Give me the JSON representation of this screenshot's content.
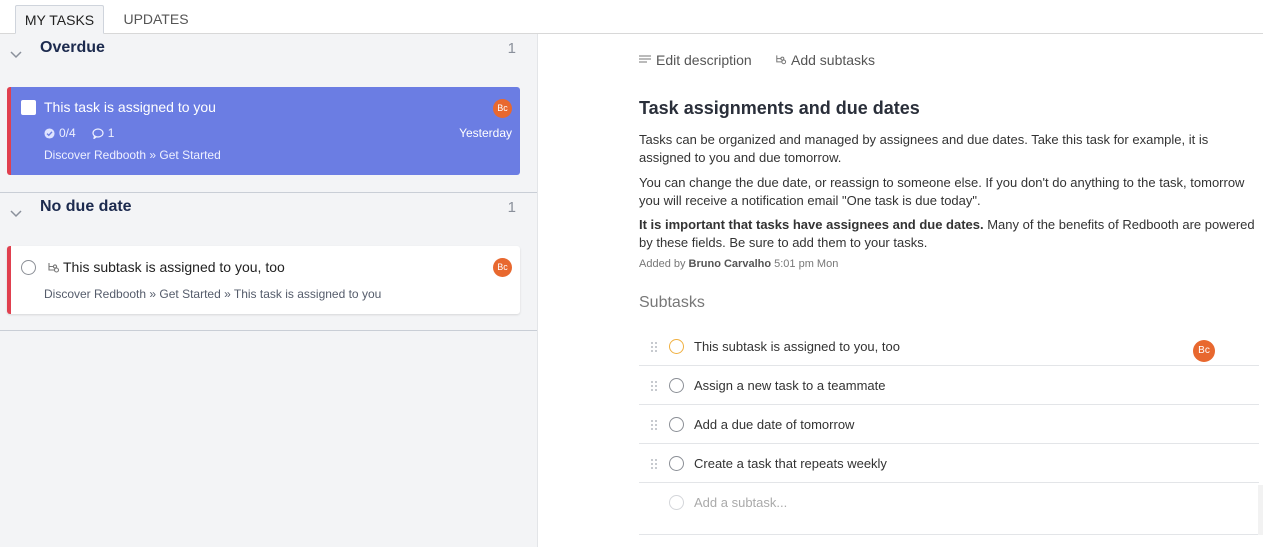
{
  "tabs": [
    {
      "label": "MY TASKS",
      "active": true
    },
    {
      "label": "UPDATES",
      "active": false
    }
  ],
  "groups": {
    "overdue": {
      "title": "Overdue",
      "count": "1"
    },
    "no_due": {
      "title": "No due date",
      "count": "1"
    }
  },
  "tasks": {
    "selected": {
      "title": "This task is assigned to you",
      "subtasks_progress": "0/4",
      "comments": "1",
      "crumb": "Discover Redbooth » Get Started",
      "due": "Yesterday",
      "avatar": "Bc"
    },
    "subtask": {
      "title": "This subtask is assigned to you, too",
      "crumb": "Discover Redbooth » Get Started » This task is assigned to you",
      "avatar": "Bc"
    }
  },
  "detail": {
    "edit_label": "Edit description",
    "add_sub_label": "Add subtasks",
    "title": "Task assignments and due dates",
    "p1": "Tasks can be organized and managed by assignees and due dates. Take this task for example, it is assigned to you and due tomorrow.",
    "p2": "You can change the due date, or reassign to someone else. If you don't do anything to the task, tomorrow you will receive a notification email \"One task is due today\".",
    "p3_bold": "It is important that tasks have assignees and due dates.",
    "p3_rest": " Many of the benefits of Redbooth are powered by these fields. Be sure to add them to your tasks.",
    "added_prefix": "Added by",
    "added_by": "Bruno Carvalho",
    "added_time": "5:01 pm Mon",
    "subtasks_heading": "Subtasks",
    "subtasks": [
      {
        "label": "This subtask is assigned to you, too",
        "avatar": "Bc"
      },
      {
        "label": "Assign a new task to a teammate"
      },
      {
        "label": "Add a due date of tomorrow"
      },
      {
        "label": "Create a task that repeats weekly"
      }
    ],
    "add_subtask_placeholder": "Add a subtask..."
  },
  "colors": {
    "accent": "#6b7de3",
    "overdue": "#e0404f",
    "avatar": "#e8682f"
  }
}
